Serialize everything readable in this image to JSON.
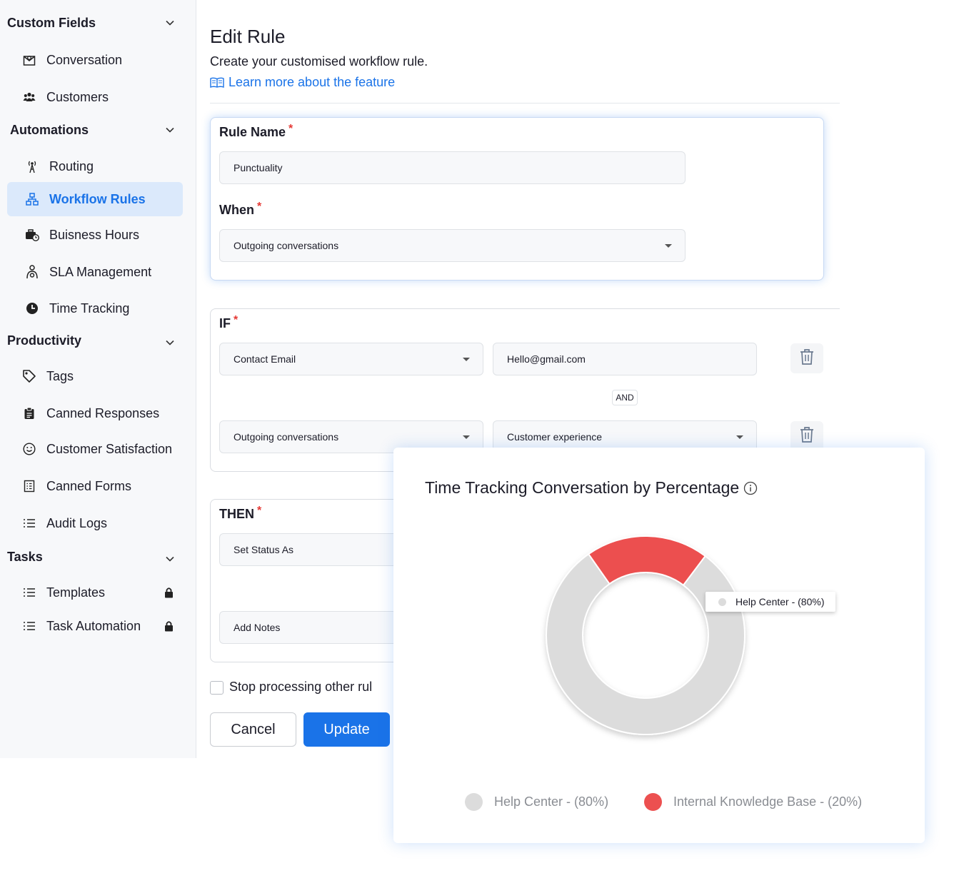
{
  "sidebar": {
    "sections": [
      {
        "label": "Custom Fields"
      },
      {
        "label": "Automations"
      },
      {
        "label": "Productivity"
      },
      {
        "label": "Tasks"
      }
    ],
    "items": [
      {
        "label": "Conversation",
        "icon": "envelope-user-icon"
      },
      {
        "label": "Customers",
        "icon": "users-icon"
      },
      {
        "label": "Routing",
        "icon": "antenna-icon"
      },
      {
        "label": "Workflow Rules",
        "icon": "sitemap-icon",
        "active": true
      },
      {
        "label": "Buisness Hours",
        "icon": "briefcase-clock-icon"
      },
      {
        "label": "SLA Management",
        "icon": "person-gear-icon"
      },
      {
        "label": "Time Tracking",
        "icon": "clock-icon"
      },
      {
        "label": "Tags",
        "icon": "tag-icon"
      },
      {
        "label": "Canned Responses",
        "icon": "clipboard-icon"
      },
      {
        "label": "Customer Satisfaction",
        "icon": "smile-icon"
      },
      {
        "label": "Canned Forms",
        "icon": "form-icon"
      },
      {
        "label": "Audit Logs",
        "icon": "list-icon"
      },
      {
        "label": "Templates",
        "icon": "list-icon",
        "locked": true
      },
      {
        "label": "Task Automation",
        "icon": "list-icon",
        "locked": true
      }
    ]
  },
  "main": {
    "title": "Edit Rule",
    "subtitle": "Create your customised workflow rule.",
    "learn_more": "Learn more about the feature",
    "rule_name_label": "Rule Name",
    "rule_name_value": "Punctuality",
    "when_label": "When",
    "when_value": "Outgoing conversations",
    "if_label": "IF",
    "conditions": [
      {
        "field": "Contact Email",
        "value": "Hello@gmail.com"
      },
      {
        "field": "Outgoing conversations",
        "value": "Customer experience"
      }
    ],
    "and_label": "AND",
    "then_label": "THEN",
    "actions": [
      {
        "field": "Set Status As"
      },
      {
        "field": "Add Notes"
      }
    ],
    "stop_processing_label": "Stop processing other rul",
    "cancel_label": "Cancel",
    "update_label": "Update",
    "required_mark": "*"
  },
  "chart_popup": {
    "title": "Time Tracking Conversation by Percentage",
    "tooltip": "Help Center - (80%)",
    "legend": [
      {
        "label": "Help Center - (80%)",
        "color": "#dcdcdc"
      },
      {
        "label": "Internal Knowledge Base - (20%)",
        "color": "#ec5050"
      }
    ]
  },
  "chart_data": {
    "type": "pie",
    "variant": "donut",
    "title": "Time Tracking Conversation by Percentage",
    "categories": [
      "Help Center",
      "Internal Knowledge Base"
    ],
    "values": [
      80,
      20
    ],
    "unit": "%",
    "colors": [
      "#dcdcdc",
      "#ec5050"
    ],
    "legend_position": "bottom"
  },
  "colors": {
    "accent": "#1a73e8",
    "active_bg": "#dbe9fb",
    "required": "#e53935"
  }
}
